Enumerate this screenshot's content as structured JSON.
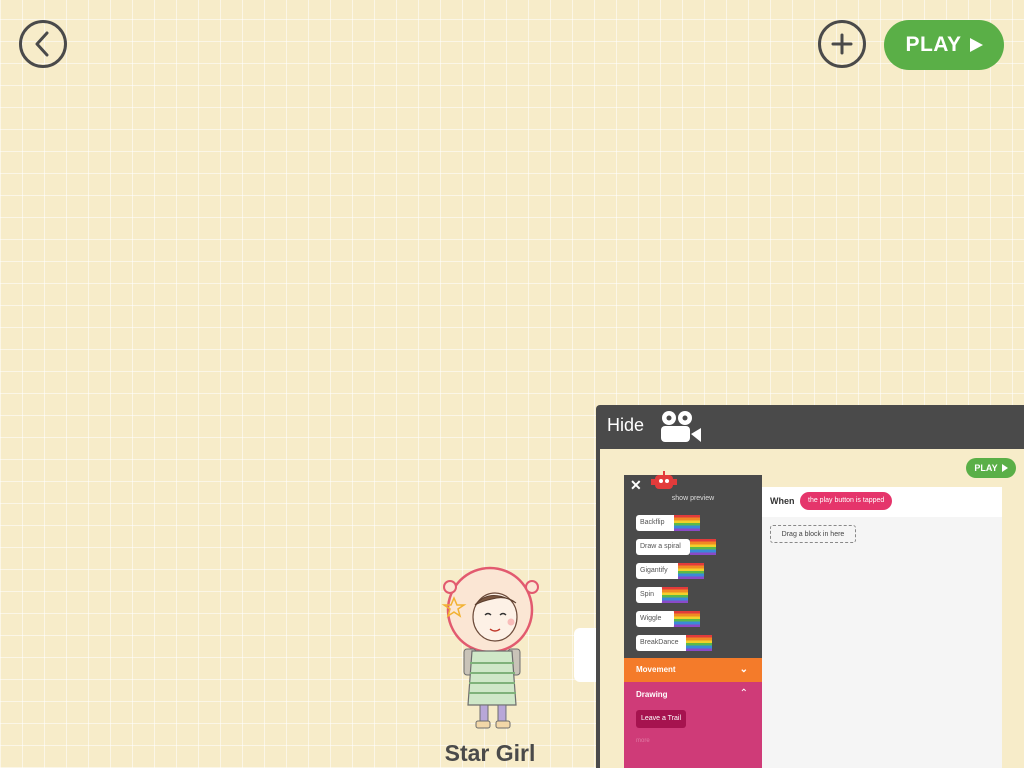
{
  "toolbar": {
    "play_label": "PLAY",
    "back_icon": "chevron-left-icon",
    "add_icon": "plus-icon",
    "play_icon": "play-triangle-icon"
  },
  "character": {
    "name": "Star Girl"
  },
  "video_preview": {
    "hide_label": "Hide",
    "camera_icon": "video-camera-icon",
    "play_label": "PLAY",
    "close_icon": "close-icon",
    "show_preview_label": "show preview",
    "blocks": [
      "Backflip",
      "Draw a spiral",
      "Gigantify",
      "Spin",
      "Wiggle",
      "BreakDance"
    ],
    "movement_label": "Movement",
    "drawing_label": "Drawing",
    "drawing_block": "Leave a Trail",
    "more_label": "more",
    "when_label": "When",
    "trigger_label": "the play button is tapped",
    "drop_label": "Drag a block in here"
  },
  "colors": {
    "background": "#f7ecc9",
    "play_green": "#5aaf47",
    "panel_dark": "#4a4a4a",
    "movement_orange": "#f47b2a",
    "drawing_pink": "#cf3b78",
    "trigger_pink": "#e5356b"
  }
}
